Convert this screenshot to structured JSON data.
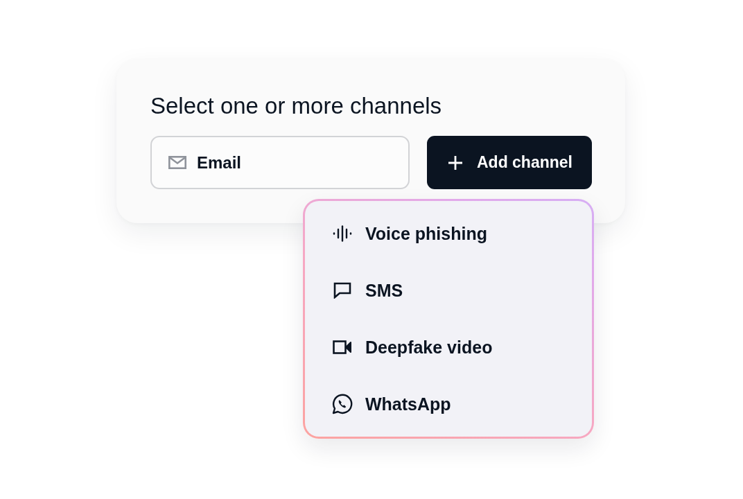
{
  "prompt": {
    "title": "Select one or more channels"
  },
  "selected_channel": {
    "label": "Email"
  },
  "add_button": {
    "label": "Add channel"
  },
  "dropdown": {
    "items": [
      {
        "label": "Voice phishing",
        "kind": "voice"
      },
      {
        "label": "SMS",
        "kind": "sms"
      },
      {
        "label": "Deepfake video",
        "kind": "video"
      },
      {
        "label": "WhatsApp",
        "kind": "whatsapp"
      }
    ]
  }
}
